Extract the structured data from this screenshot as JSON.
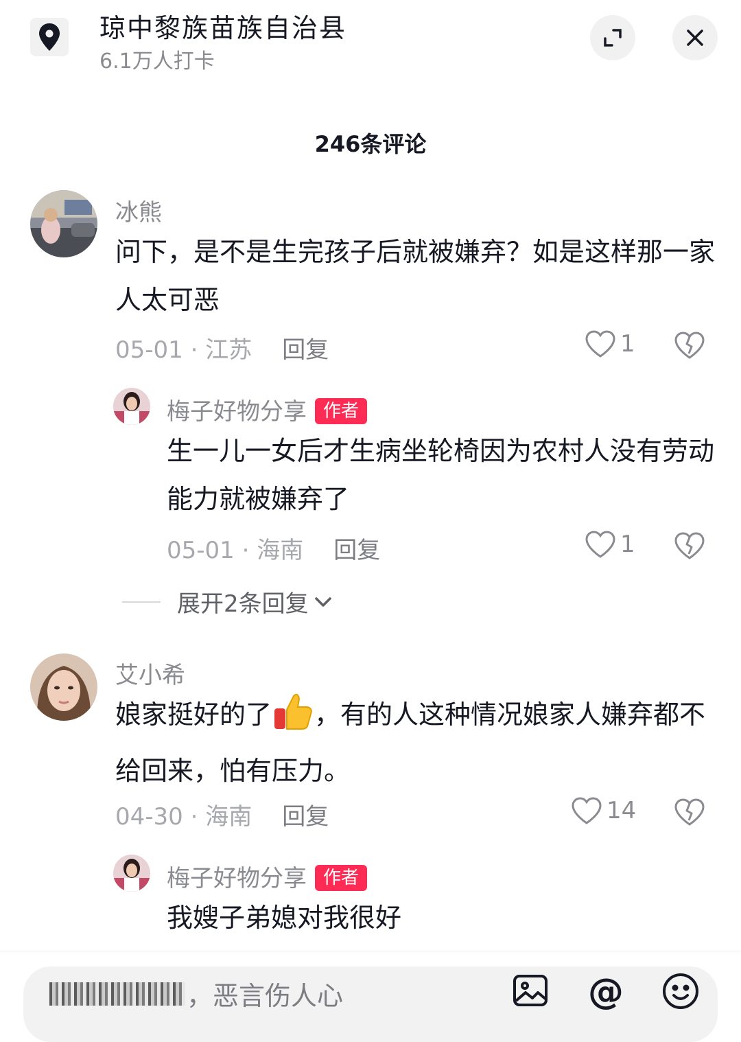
{
  "header": {
    "location_title": "琼中黎族苗族自治县",
    "checkins": "6.1万人打卡"
  },
  "comment_count": "246条评论",
  "comments": [
    {
      "user": "冰熊",
      "text": "问下，是不是生完孩子后就被嫌弃？如是这样那一家人太可恶",
      "date_loc": "05-01 · 江苏",
      "reply_label": "回复",
      "likes": "1",
      "reply": {
        "user": "梅子好物分享",
        "badge": "作者",
        "text": "生一儿一女后才生病坐轮椅因为农村人没有劳动能力就被嫌弃了",
        "date_loc": "05-01 · 海南",
        "reply_label": "回复",
        "likes": "1"
      },
      "expand_label": "展开2条回复"
    },
    {
      "user": "艾小希",
      "text_before": "娘家挺好的了",
      "text_after": "，有的人这种情况娘家人嫌弃都不给回来，怕有压力。",
      "date_loc": "04-30 · 海南",
      "reply_label": "回复",
      "likes": "14",
      "reply": {
        "user": "梅子好物分享",
        "badge": "作者",
        "text": "我嫂子弟媳对我很好"
      }
    }
  ],
  "input": {
    "placeholder_suffix": "，恶言伤人心"
  },
  "icons": [
    "location-pin-icon",
    "expand-icon",
    "close-icon",
    "heart-icon",
    "broken-heart-icon",
    "thumbs-up-emoji",
    "image-icon",
    "at-icon",
    "emoji-icon"
  ]
}
